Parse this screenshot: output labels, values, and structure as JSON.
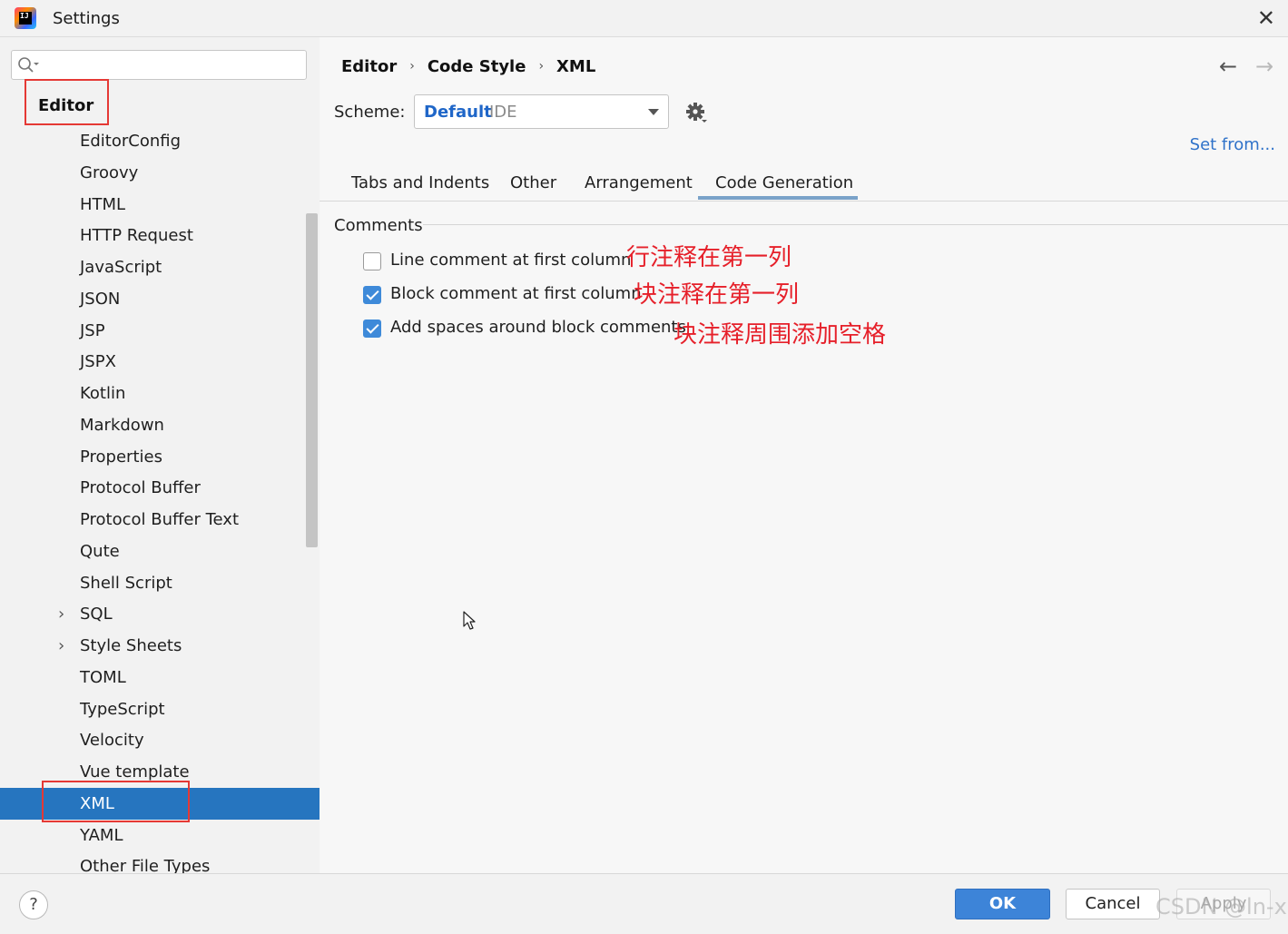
{
  "window": {
    "title": "Settings",
    "close_icon": "close-icon"
  },
  "sidebar": {
    "search_placeholder": "",
    "section_label": "Editor",
    "items": [
      {
        "label": "EditorConfig",
        "expandable": false,
        "selected": false
      },
      {
        "label": "Groovy",
        "expandable": false,
        "selected": false
      },
      {
        "label": "HTML",
        "expandable": false,
        "selected": false
      },
      {
        "label": "HTTP Request",
        "expandable": false,
        "selected": false
      },
      {
        "label": "JavaScript",
        "expandable": false,
        "selected": false
      },
      {
        "label": "JSON",
        "expandable": false,
        "selected": false
      },
      {
        "label": "JSP",
        "expandable": false,
        "selected": false
      },
      {
        "label": "JSPX",
        "expandable": false,
        "selected": false
      },
      {
        "label": "Kotlin",
        "expandable": false,
        "selected": false
      },
      {
        "label": "Markdown",
        "expandable": false,
        "selected": false
      },
      {
        "label": "Properties",
        "expandable": false,
        "selected": false
      },
      {
        "label": "Protocol Buffer",
        "expandable": false,
        "selected": false
      },
      {
        "label": "Protocol Buffer Text",
        "expandable": false,
        "selected": false
      },
      {
        "label": "Qute",
        "expandable": false,
        "selected": false
      },
      {
        "label": "Shell Script",
        "expandable": false,
        "selected": false
      },
      {
        "label": "SQL",
        "expandable": true,
        "selected": false
      },
      {
        "label": "Style Sheets",
        "expandable": true,
        "selected": false
      },
      {
        "label": "TOML",
        "expandable": false,
        "selected": false
      },
      {
        "label": "TypeScript",
        "expandable": false,
        "selected": false
      },
      {
        "label": "Velocity",
        "expandable": false,
        "selected": false
      },
      {
        "label": "Vue template",
        "expandable": false,
        "selected": false
      },
      {
        "label": "XML",
        "expandable": false,
        "selected": true
      },
      {
        "label": "YAML",
        "expandable": false,
        "selected": false
      },
      {
        "label": "Other File Types",
        "expandable": false,
        "selected": false
      }
    ],
    "chevron": "›"
  },
  "main": {
    "breadcrumb": [
      "Editor",
      "Code Style",
      "XML"
    ],
    "breadcrumb_sep": "›",
    "nav_back": "←",
    "nav_forward": "→",
    "scheme_label": "Scheme:",
    "scheme_value": "Default",
    "scheme_sub": "IDE",
    "set_from": "Set from...",
    "tabs": [
      "Tabs and Indents",
      "Other",
      "Arrangement",
      "Code Generation"
    ],
    "active_tab": "Code Generation",
    "group_title": "Comments",
    "options": [
      {
        "label": "Line comment at first column",
        "checked": false,
        "note": "行注释在第一列"
      },
      {
        "label": "Block comment at first column",
        "checked": true,
        "note": "块注释在第一列"
      },
      {
        "label": "Add spaces around block comments",
        "checked": true,
        "note": "块注释周围添加空格"
      }
    ]
  },
  "footer": {
    "help": "?",
    "ok": "OK",
    "cancel": "Cancel",
    "apply": "Apply",
    "watermark": "CSDN @ln-x"
  },
  "colors": {
    "accent": "#2675bf",
    "annotation": "#e6202a",
    "link": "#2f72c9",
    "checkbox": "#3e8ad9"
  }
}
